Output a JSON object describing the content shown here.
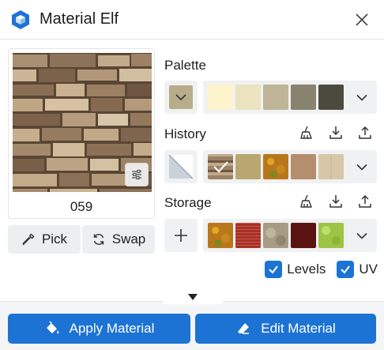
{
  "app": {
    "title": "Material Elf",
    "accent": "#1d73d3"
  },
  "preview": {
    "name": "059"
  },
  "left_buttons": {
    "pick": "Pick",
    "swap": "Swap"
  },
  "palette": {
    "label": "Palette",
    "current": "#b8ad8a",
    "swatches": [
      "#fdf4cc",
      "#ebe3bf",
      "#bdb596",
      "#87836e",
      "#4a4a3e"
    ]
  },
  "history": {
    "label": "History"
  },
  "storage": {
    "label": "Storage"
  },
  "options": {
    "levels": "Levels",
    "uv": "UV"
  },
  "actions": {
    "apply": "Apply Material",
    "edit": "Edit Material"
  }
}
